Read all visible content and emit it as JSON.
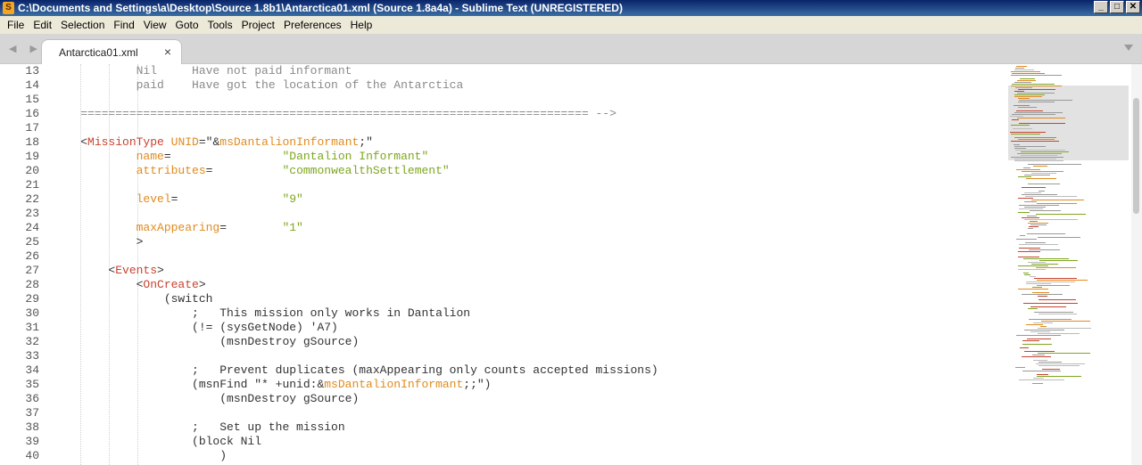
{
  "window": {
    "title": "C:\\Documents and Settings\\a\\Desktop\\Source 1.8b1\\Antarctica01.xml (Source 1.8a4a) - Sublime Text (UNREGISTERED)",
    "app_icon": "sublime-text-icon",
    "controls": {
      "minimize": "_",
      "maximize": "□",
      "close": "✕"
    }
  },
  "menu": [
    "File",
    "Edit",
    "Selection",
    "Find",
    "View",
    "Goto",
    "Tools",
    "Project",
    "Preferences",
    "Help"
  ],
  "tabs": {
    "nav_arrows": "◀ ▶",
    "items": [
      {
        "label": "Antarctica01.xml",
        "close": "×"
      }
    ]
  },
  "colors": {
    "tag": "#c8432f",
    "attribute": "#e08b1e",
    "string": "#7ea620",
    "comment": "#8a8a8a"
  },
  "code_lines": [
    {
      "n": "13",
      "parts": [
        {
          "t": "            Nil     Have not paid informant",
          "c": "comment"
        }
      ]
    },
    {
      "n": "14",
      "parts": [
        {
          "t": "            paid    Have got the location of the Antarctica",
          "c": "comment"
        }
      ]
    },
    {
      "n": "15",
      "parts": []
    },
    {
      "n": "16",
      "parts": [
        {
          "t": "    ========================================================================= -->",
          "c": "comment"
        }
      ]
    },
    {
      "n": "17",
      "parts": []
    },
    {
      "n": "18",
      "parts": [
        {
          "t": "    <",
          "c": "plain"
        },
        {
          "t": "MissionType",
          "c": "tag"
        },
        {
          "t": " UNID",
          "c": "attr"
        },
        {
          "t": "=\"&",
          "c": "plain"
        },
        {
          "t": "msDantalionInformant",
          "c": "attr"
        },
        {
          "t": ";\"",
          "c": "plain"
        }
      ]
    },
    {
      "n": "19",
      "parts": [
        {
          "t": "            name",
          "c": "attr"
        },
        {
          "t": "=",
          "c": "plain"
        },
        {
          "t": "                \"Dantalion Informant\"",
          "c": "str"
        }
      ]
    },
    {
      "n": "20",
      "parts": [
        {
          "t": "            attributes",
          "c": "attr"
        },
        {
          "t": "=",
          "c": "plain"
        },
        {
          "t": "          \"commonwealthSettlement\"",
          "c": "str"
        }
      ]
    },
    {
      "n": "21",
      "parts": []
    },
    {
      "n": "22",
      "parts": [
        {
          "t": "            level",
          "c": "attr"
        },
        {
          "t": "=",
          "c": "plain"
        },
        {
          "t": "               \"9\"",
          "c": "str"
        }
      ]
    },
    {
      "n": "23",
      "parts": []
    },
    {
      "n": "24",
      "parts": [
        {
          "t": "            maxAppearing",
          "c": "attr"
        },
        {
          "t": "=",
          "c": "plain"
        },
        {
          "t": "        \"1\"",
          "c": "str"
        }
      ]
    },
    {
      "n": "25",
      "parts": [
        {
          "t": "            >",
          "c": "plain"
        }
      ]
    },
    {
      "n": "26",
      "parts": []
    },
    {
      "n": "27",
      "parts": [
        {
          "t": "        <",
          "c": "plain"
        },
        {
          "t": "Events",
          "c": "tag"
        },
        {
          "t": ">",
          "c": "plain"
        }
      ]
    },
    {
      "n": "28",
      "parts": [
        {
          "t": "            <",
          "c": "plain"
        },
        {
          "t": "OnCreate",
          "c": "tag"
        },
        {
          "t": ">",
          "c": "plain"
        }
      ]
    },
    {
      "n": "29",
      "parts": [
        {
          "t": "                (switch",
          "c": "plain"
        }
      ]
    },
    {
      "n": "30",
      "parts": [
        {
          "t": "                    ;   This mission only works in Dantalion",
          "c": "plain"
        }
      ]
    },
    {
      "n": "31",
      "parts": [
        {
          "t": "                    (!= (sysGetNode) 'A7)",
          "c": "plain"
        }
      ]
    },
    {
      "n": "32",
      "parts": [
        {
          "t": "                        (msnDestroy gSource)",
          "c": "plain"
        }
      ]
    },
    {
      "n": "33",
      "parts": []
    },
    {
      "n": "34",
      "parts": [
        {
          "t": "                    ;   Prevent duplicates (maxAppearing only counts accepted missions)",
          "c": "plain"
        }
      ]
    },
    {
      "n": "35",
      "parts": [
        {
          "t": "                    (msnFind \"* +unid:&",
          "c": "plain"
        },
        {
          "t": "msDantalionInformant",
          "c": "attr"
        },
        {
          "t": ";;\")",
          "c": "plain"
        }
      ]
    },
    {
      "n": "36",
      "parts": [
        {
          "t": "                        (msnDestroy gSource)",
          "c": "plain"
        }
      ]
    },
    {
      "n": "37",
      "parts": []
    },
    {
      "n": "38",
      "parts": [
        {
          "t": "                    ;   Set up the mission",
          "c": "plain"
        }
      ]
    },
    {
      "n": "39",
      "parts": [
        {
          "t": "                    (block Nil",
          "c": "plain"
        }
      ]
    },
    {
      "n": "40",
      "parts": [
        {
          "t": "                        )",
          "c": "plain"
        }
      ]
    }
  ]
}
